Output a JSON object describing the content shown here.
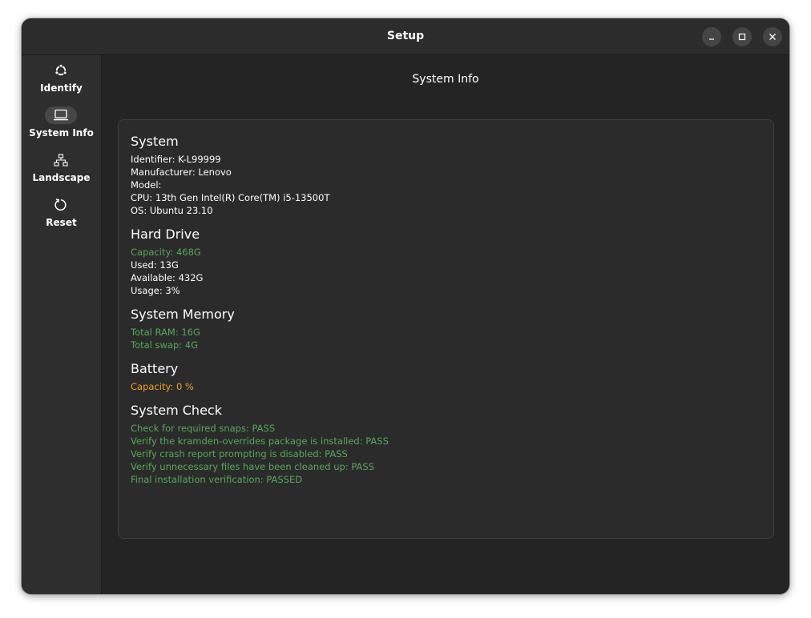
{
  "window": {
    "title": "Setup"
  },
  "window_controls": {
    "minimize": "minimize",
    "maximize": "maximize",
    "close": "close"
  },
  "sidebar": {
    "items": [
      {
        "label": "Identify",
        "icon": "ubuntu-logo-icon",
        "active": false
      },
      {
        "label": "System Info",
        "icon": "computer-icon",
        "active": true
      },
      {
        "label": "Landscape",
        "icon": "network-icon",
        "active": false
      },
      {
        "label": "Reset",
        "icon": "reset-icon",
        "active": false
      }
    ]
  },
  "main": {
    "title": "System Info",
    "system": {
      "heading": "System",
      "identifier": "Identifier: K-L99999",
      "manufacturer": "Manufacturer: Lenovo",
      "model": "Model:",
      "cpu": "CPU: 13th Gen Intel(R) Core(TM) i5-13500T",
      "os": "OS: Ubuntu 23.10"
    },
    "hard_drive": {
      "heading": "Hard Drive",
      "capacity": "Capacity: 468G",
      "used": "Used: 13G",
      "available": "Available: 432G",
      "usage": "Usage: 3%"
    },
    "memory": {
      "heading": "System Memory",
      "total_ram": "Total RAM: 16G",
      "total_swap": "Total swap: 4G"
    },
    "battery": {
      "heading": "Battery",
      "capacity": "Capacity: 0 %"
    },
    "system_check": {
      "heading": "System Check",
      "items": [
        "Check for required snaps:  PASS",
        "Verify the kramden-overrides package is installed: PASS",
        "Verify crash report prompting is disabled: PASS",
        "Verify unnecessary files have been cleaned up: PASS",
        "Final installation verification: PASSED"
      ]
    }
  },
  "colors": {
    "background": "#242424",
    "sidebar": "#2e2e2e",
    "card": "#2b2b2b",
    "pass_green": "#57a85a",
    "warning_orange": "#f0a020",
    "text": "#ffffff"
  }
}
